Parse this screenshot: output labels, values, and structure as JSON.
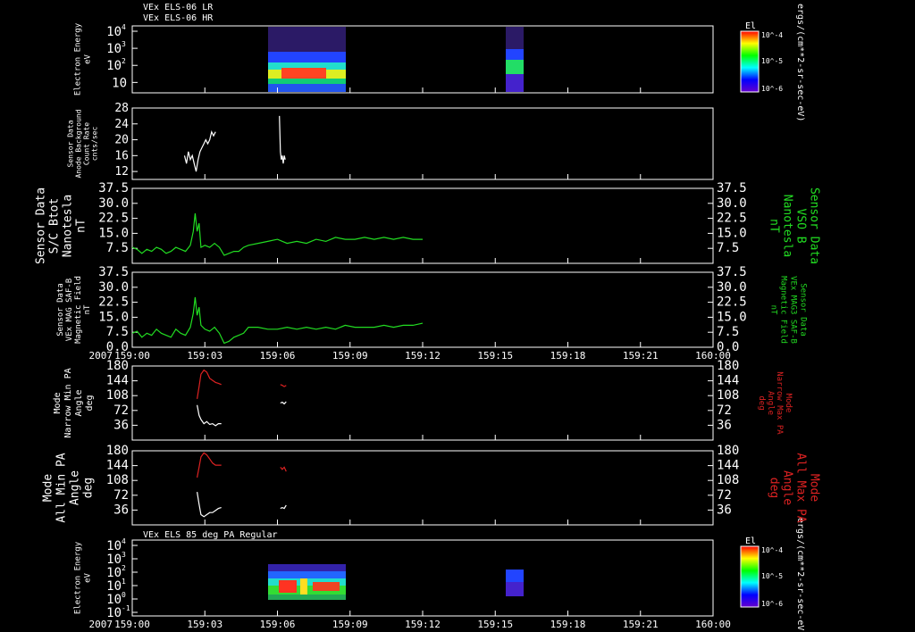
{
  "colors": {
    "bg": "#000000",
    "axis": "#ffffff",
    "trace": "#ffffff",
    "green": "#22dd22",
    "red": "#dd2222"
  },
  "chart_data": [
    {
      "type": "heatmap",
      "header_lines": [
        "VEx ELS-06 LR",
        "VEx ELS-06 HR"
      ],
      "ylabel_lines": [
        "Electron Energy",
        "eV"
      ],
      "yticks": [
        "10^4",
        "10^3",
        "10^2",
        "10"
      ],
      "colorbar": {
        "title": "El",
        "ticks": [
          "10^-4",
          "10^-5",
          "10^-6"
        ],
        "unit": "ergs/(cm**2-sr-sec-eV)"
      },
      "data_blocks": [
        {
          "t_start": "159:05:25",
          "t_end": "159:08:30"
        },
        {
          "t_start": "159:15:15",
          "t_end": "159:15:50"
        }
      ]
    },
    {
      "type": "line",
      "ylabel_lines": [
        "Sensor Data",
        "Anode Background",
        "Count Rate",
        "cnts/sec"
      ],
      "ylim": [
        10,
        28
      ],
      "yticks": [
        12,
        16,
        20,
        24,
        28
      ],
      "series": [
        {
          "x": [
            5.4,
            5.6,
            5.8,
            6.0,
            6.2,
            6.4,
            6.6,
            6.8,
            7.0,
            7.2,
            7.4,
            7.6,
            7.8,
            8.0,
            8.2,
            8.4,
            8.6
          ],
          "y": [
            16,
            14,
            17,
            15,
            16,
            14,
            12,
            15,
            17,
            18,
            19,
            20,
            19,
            20,
            22,
            21,
            22
          ]
        },
        {
          "x": [
            15.2,
            15.3,
            15.4,
            15.5,
            15.6,
            15.7,
            15.8
          ],
          "y": [
            26,
            17,
            15,
            16,
            14,
            16,
            15
          ]
        }
      ]
    },
    {
      "type": "line",
      "ylabel_lines": [
        "Sensor Data",
        "S/C Btot",
        "Nanotesla",
        "nT"
      ],
      "right_label_lines": [
        "Sensor Data",
        "VSO B",
        "Nanotesla",
        "nT"
      ],
      "ylim": [
        0,
        37.5
      ],
      "yticks": [
        "7.5",
        "15.0",
        "22.5",
        "30.0",
        "37.5"
      ],
      "series": [
        {
          "x": [
            0,
            0.5,
            1,
            1.5,
            2,
            2.5,
            3,
            3.5,
            4,
            4.5,
            5,
            5.5,
            6,
            6.3,
            6.5,
            6.7,
            6.9,
            7.1,
            7.5,
            8,
            8.5,
            9,
            9.5,
            10,
            10.5,
            11,
            11.5,
            12,
            13,
            14,
            15,
            16,
            17,
            18,
            19,
            20,
            21,
            22,
            23,
            24,
            25,
            26,
            27,
            28,
            29,
            30
          ],
          "y": [
            8,
            7,
            5,
            7,
            6,
            8,
            7,
            5,
            6,
            8,
            7,
            6,
            9,
            16,
            25,
            16,
            20,
            8,
            9,
            8,
            10,
            8,
            4,
            5,
            6,
            6,
            8,
            9,
            10,
            11,
            12,
            10,
            11,
            10,
            12,
            11,
            13,
            12,
            12,
            13,
            12,
            13,
            12,
            13,
            12,
            12
          ]
        }
      ]
    },
    {
      "type": "line",
      "ylabel_lines": [
        "Sensor Data",
        "VEx MAG SAF-B",
        "Magnetic Field",
        "nT"
      ],
      "right_label_lines": [
        "Sensor Data",
        "VEx MAG3 SAF-B",
        "Magnetic Field",
        "nT"
      ],
      "ylim": [
        0,
        37.5
      ],
      "yticks": [
        "0.0",
        "7.5",
        "15.0",
        "22.5",
        "30.0",
        "37.5"
      ],
      "series": [
        {
          "x": [
            0,
            0.5,
            1,
            1.5,
            2,
            2.5,
            3,
            3.5,
            4,
            4.5,
            5,
            5.5,
            6,
            6.3,
            6.5,
            6.7,
            6.9,
            7.1,
            7.5,
            8,
            8.5,
            9,
            9.5,
            10,
            10.5,
            11,
            11.5,
            12,
            13,
            14,
            15,
            16,
            17,
            18,
            19,
            20,
            21,
            22,
            23,
            24,
            25,
            26,
            27,
            28,
            29,
            30
          ],
          "y": [
            7,
            8,
            5,
            7,
            6,
            9,
            7,
            6,
            5,
            9,
            7,
            6,
            10,
            17,
            25,
            16,
            20,
            11,
            9,
            8,
            10,
            7,
            2,
            3,
            5,
            6,
            7,
            10,
            10,
            9,
            9,
            10,
            9,
            10,
            9,
            10,
            9,
            11,
            10,
            10,
            10,
            11,
            10,
            11,
            11,
            12
          ]
        }
      ],
      "xaxis": {
        "label": "2007",
        "ticks": [
          "159:00",
          "159:03",
          "159:06",
          "159:09",
          "159:12",
          "159:15",
          "159:18",
          "159:21",
          "160:00"
        ]
      }
    },
    {
      "type": "line",
      "ylabel_lines": [
        "Mode",
        "Narrow Min PA",
        "Angle",
        "deg"
      ],
      "right_label_lines": [
        "Mode",
        "Narrow Max PA",
        "Angle",
        "deg"
      ],
      "ylim": [
        0,
        180
      ],
      "yticks": [
        36,
        72,
        108,
        144,
        180
      ],
      "series": [
        {
          "name": "max",
          "x": [
            6.7,
            6.9,
            7.1,
            7.4,
            7.7,
            8.0,
            8.3,
            8.6,
            8.9,
            9.2
          ],
          "y": [
            100,
            130,
            160,
            170,
            165,
            150,
            145,
            140,
            138,
            135
          ]
        },
        {
          "name": "max2",
          "x": [
            15.3,
            15.5,
            15.7,
            15.9
          ],
          "y": [
            135,
            133,
            130,
            133
          ]
        },
        {
          "name": "min",
          "x": [
            6.7,
            6.9,
            7.1,
            7.4,
            7.7,
            8.0,
            8.3,
            8.6,
            8.9,
            9.2
          ],
          "y": [
            85,
            60,
            50,
            40,
            45,
            38,
            40,
            35,
            40,
            40
          ]
        },
        {
          "name": "min2",
          "x": [
            15.3,
            15.5,
            15.7,
            15.9
          ],
          "y": [
            90,
            92,
            88,
            93
          ]
        }
      ]
    },
    {
      "type": "line",
      "ylabel_lines": [
        "Mode",
        "All Min PA",
        "Angle",
        "deg"
      ],
      "right_label_lines": [
        "Mode",
        "All Max PA",
        "Angle",
        "deg"
      ],
      "ylim": [
        0,
        180
      ],
      "yticks": [
        36,
        72,
        108,
        144,
        180
      ],
      "series": [
        {
          "name": "max",
          "x": [
            6.7,
            6.9,
            7.1,
            7.4,
            7.7,
            8.0,
            8.3,
            8.6,
            8.9,
            9.2
          ],
          "y": [
            115,
            140,
            165,
            175,
            170,
            160,
            150,
            145,
            145,
            145
          ]
        },
        {
          "name": "max2",
          "x": [
            15.3,
            15.5,
            15.7,
            15.9
          ],
          "y": [
            140,
            135,
            140,
            130
          ]
        },
        {
          "name": "min",
          "x": [
            6.7,
            6.9,
            7.1,
            7.4,
            7.7,
            8.0,
            8.3,
            8.6,
            8.9,
            9.2
          ],
          "y": [
            80,
            50,
            25,
            20,
            25,
            30,
            30,
            35,
            40,
            42
          ]
        },
        {
          "name": "min2",
          "x": [
            15.3,
            15.5,
            15.7,
            15.9
          ],
          "y": [
            40,
            42,
            40,
            48
          ]
        }
      ]
    },
    {
      "type": "heatmap",
      "header": "VEx ELS 85 deg PA Regular",
      "ylabel_lines": [
        "Electron Energy",
        "eV"
      ],
      "yticks": [
        "10^4",
        "10^3",
        "10^2",
        "10^1",
        "10^0",
        "10^-1"
      ],
      "colorbar": {
        "title": "El",
        "ticks": [
          "10^-4",
          "10^-5",
          "10^-6"
        ],
        "unit": "ergs/(cm**2-sr-sec-eV)"
      },
      "xaxis": {
        "label": "2007",
        "ticks": [
          "159:00",
          "159:03",
          "159:06",
          "159:09",
          "159:12",
          "159:15",
          "159:18",
          "159:21",
          "160:00"
        ]
      }
    }
  ]
}
